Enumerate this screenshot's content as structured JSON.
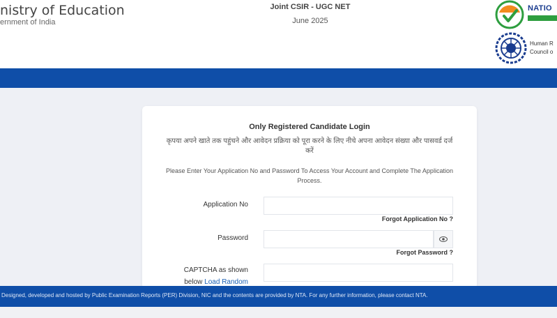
{
  "header": {
    "ministry_title": "nistry of Education",
    "ministry_sub": "ernment of India",
    "exam_title": "Joint CSIR - UGC NET",
    "exam_session": "June 2025",
    "nta_name": "NATIO",
    "csir_text_1": "Human R",
    "csir_text_2": "Council o",
    "colors": {
      "band": "#0f4ea8",
      "nta_green": "#2e9e3f",
      "nta_orange": "#f28c1e"
    }
  },
  "login": {
    "title": "Only Registered Candidate Login",
    "hindi_message": "कृपया अपने खाते तक पहुंचने और आवेदन प्रक्रिया को पूरा करने के लिए नीचे अपना आवेदन संख्या और पासवर्ड दर्ज करें",
    "english_message": "Please Enter Your Application No and Password To Access Your Account and Complete The Application Process.",
    "application_label": "Application No",
    "application_value": "",
    "forgot_application": "Forgot Application No ?",
    "password_label": "Password",
    "password_value": "",
    "eye_icon": "eye-icon",
    "forgot_password": "Forgot Password ?",
    "captcha_label_1": "CAPTCHA as shown",
    "captcha_label_2": "below",
    "captcha_reload": "Load Random",
    "captcha_value": ""
  },
  "footer": {
    "text": "Designed, developed and hosted by Public Examination Reports (PER) Division, NIC and the contents are provided by NTA. For any further information, please contact NTA."
  }
}
